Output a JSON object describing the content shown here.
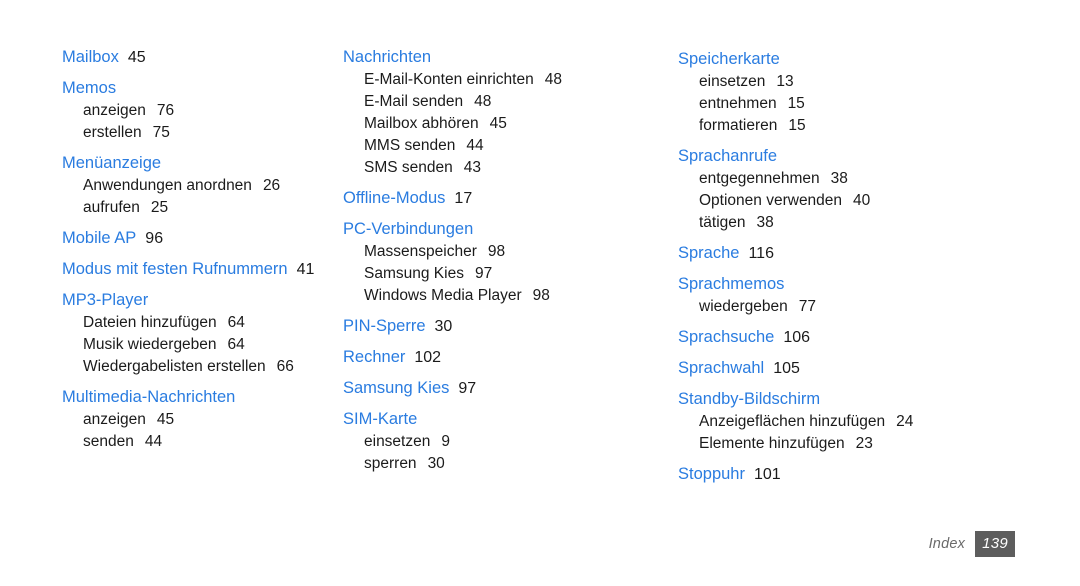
{
  "document": {
    "type": "index",
    "footer": {
      "label": "Index",
      "page_number": "139"
    },
    "colors": {
      "heading": "#2a7ce0",
      "body": "#1b1b1b",
      "footer_label": "#6b6b6b",
      "footer_box": "#5d5d5d",
      "background": "#ffffff"
    }
  },
  "columns": [
    {
      "id": "column-1",
      "groups": [
        {
          "heading": "Mailbox",
          "page": "45",
          "subentries": []
        },
        {
          "heading": "Memos",
          "page": "",
          "subentries": [
            {
              "label": "anzeigen",
              "page": "76"
            },
            {
              "label": "erstellen",
              "page": "75"
            }
          ]
        },
        {
          "heading": "Menüanzeige",
          "page": "",
          "subentries": [
            {
              "label": "Anwendungen anordnen",
              "page": "26"
            },
            {
              "label": "aufrufen",
              "page": "25"
            }
          ]
        },
        {
          "heading": "Mobile AP",
          "page": "96",
          "subentries": []
        },
        {
          "heading": "Modus mit festen Rufnummern",
          "page": "41",
          "subentries": []
        },
        {
          "heading": "MP3-Player",
          "page": "",
          "subentries": [
            {
              "label": "Dateien hinzufügen",
              "page": "64"
            },
            {
              "label": "Musik wiedergeben",
              "page": "64"
            },
            {
              "label": "Wiedergabelisten erstellen",
              "page": "66"
            }
          ]
        },
        {
          "heading": "Multimedia-Nachrichten",
          "page": "",
          "subentries": [
            {
              "label": "anzeigen",
              "page": "45"
            },
            {
              "label": "senden",
              "page": "44"
            }
          ]
        }
      ]
    },
    {
      "id": "column-2",
      "groups": [
        {
          "heading": "Nachrichten",
          "page": "",
          "subentries": [
            {
              "label": "E-Mail-Konten einrichten",
              "page": "48"
            },
            {
              "label": "E-Mail senden",
              "page": "48"
            },
            {
              "label": "Mailbox abhören",
              "page": "45"
            },
            {
              "label": "MMS senden",
              "page": "44"
            },
            {
              "label": "SMS senden",
              "page": "43"
            }
          ]
        },
        {
          "heading": "Offline-Modus",
          "page": "17",
          "subentries": []
        },
        {
          "heading": "PC-Verbindungen",
          "page": "",
          "subentries": [
            {
              "label": "Massenspeicher",
              "page": "98"
            },
            {
              "label": "Samsung Kies",
              "page": "97"
            },
            {
              "label": "Windows Media Player",
              "page": "98"
            }
          ]
        },
        {
          "heading": "PIN-Sperre",
          "page": "30",
          "subentries": []
        },
        {
          "heading": "Rechner",
          "page": "102",
          "subentries": []
        },
        {
          "heading": "Samsung Kies",
          "page": "97",
          "subentries": []
        },
        {
          "heading": "SIM-Karte",
          "page": "",
          "subentries": [
            {
              "label": "einsetzen",
              "page": "9"
            },
            {
              "label": "sperren",
              "page": "30"
            }
          ]
        }
      ]
    },
    {
      "id": "column-3",
      "groups": [
        {
          "heading": "Speicherkarte",
          "page": "",
          "subentries": [
            {
              "label": "einsetzen",
              "page": "13"
            },
            {
              "label": "entnehmen",
              "page": "15"
            },
            {
              "label": "formatieren",
              "page": "15"
            }
          ]
        },
        {
          "heading": "Sprachanrufe",
          "page": "",
          "subentries": [
            {
              "label": "entgegennehmen",
              "page": "38"
            },
            {
              "label": "Optionen verwenden",
              "page": "40"
            },
            {
              "label": "tätigen",
              "page": "38"
            }
          ]
        },
        {
          "heading": "Sprache",
          "page": "116",
          "subentries": []
        },
        {
          "heading": "Sprachmemos",
          "page": "",
          "subentries": [
            {
              "label": "wiedergeben",
              "page": "77"
            }
          ]
        },
        {
          "heading": "Sprachsuche",
          "page": "106",
          "subentries": []
        },
        {
          "heading": "Sprachwahl",
          "page": "105",
          "subentries": []
        },
        {
          "heading": "Standby-Bildschirm",
          "page": "",
          "subentries": [
            {
              "label": "Anzeigeflächen hinzufügen",
              "page": "24"
            },
            {
              "label": "Elemente hinzufügen",
              "page": "23"
            }
          ]
        },
        {
          "heading": "Stoppuhr",
          "page": "101",
          "subentries": []
        }
      ]
    }
  ]
}
